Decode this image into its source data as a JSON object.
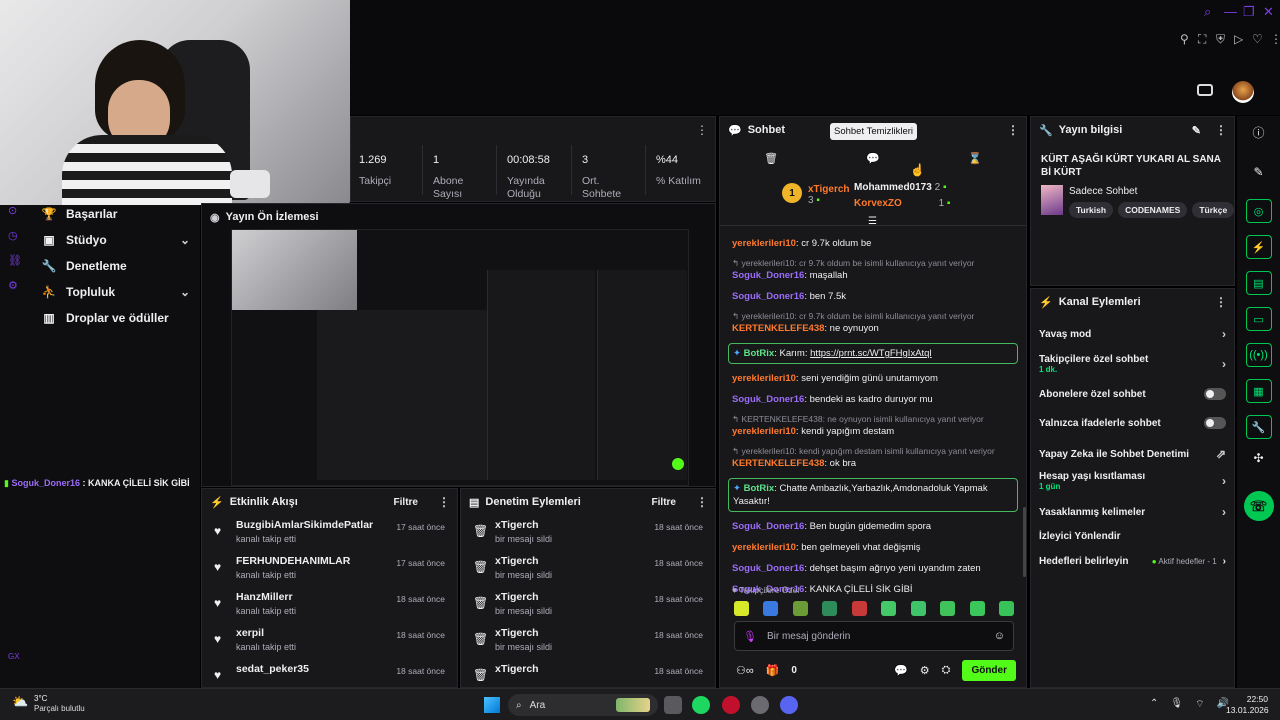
{
  "stats": [
    {
      "value": "1.269",
      "label": "Takipçi"
    },
    {
      "value": "1",
      "label": "Abone Sayısı"
    },
    {
      "value": "00:08:58",
      "label": "Yayında Olduğu"
    },
    {
      "value": "3",
      "label": "Ort. Sohbete"
    },
    {
      "value": "%44",
      "label": "% Katılım"
    }
  ],
  "nav": {
    "items": [
      {
        "label": "Başarılar",
        "icon": "trophy-icon"
      },
      {
        "label": "Stüdyo",
        "icon": "studio-icon"
      },
      {
        "label": "Denetleme",
        "icon": "wrench-icon"
      },
      {
        "label": "Topluluk",
        "icon": "community-icon"
      },
      {
        "label": "Droplar ve ödüller",
        "icon": "gift-icon"
      }
    ]
  },
  "overlay_chat": {
    "user": "Soguk_Doner16",
    "text": " : KANKA ÇİLELİ SİK GİBİ"
  },
  "corner_tag": "GX",
  "preview": {
    "title": "Yayın Ön İzlemesi"
  },
  "activity": {
    "title": "Etkinlik Akışı",
    "filter": "Filtre",
    "items": [
      {
        "name": "BuzgibiAmlarSikimdePatlar",
        "sub": "kanalı takip etti",
        "time": "17 saat önce"
      },
      {
        "name": "FERHUNDEHANIMLAR",
        "sub": "kanalı takip etti",
        "time": "17 saat önce"
      },
      {
        "name": "HanzMillerr",
        "sub": "kanalı takip etti",
        "time": "18 saat önce"
      },
      {
        "name": "xerpil",
        "sub": "kanalı takip etti",
        "time": "18 saat önce"
      },
      {
        "name": "sedat_peker35",
        "sub": "",
        "time": "18 saat önce"
      }
    ]
  },
  "modlog": {
    "title": "Denetim Eylemleri",
    "filter": "Filtre",
    "items": [
      {
        "name": "xTigerch",
        "sub": "bir mesajı sildi",
        "time": "18 saat önce"
      },
      {
        "name": "xTigerch",
        "sub": "bir mesajı sildi",
        "time": "18 saat önce"
      },
      {
        "name": "xTigerch",
        "sub": "bir mesajı sildi",
        "time": "18 saat önce"
      },
      {
        "name": "xTigerch",
        "sub": "bir mesajı sildi",
        "time": "18 saat önce"
      },
      {
        "name": "xTigerch",
        "sub": "",
        "time": "18 saat önce"
      }
    ]
  },
  "chat": {
    "title": "Sohbet",
    "tooltip": "Sohbet Temizlikleri",
    "leaderboard": {
      "rank": "1",
      "top_user": "xTigerch",
      "top_count": "3",
      "second_user": "Mohammed0173",
      "second_count": "2",
      "third_user": "KorvexZO",
      "third_count": "1"
    },
    "messages": [
      {
        "reply": "",
        "user": "yereklerileri10",
        "color": "orange",
        "text": ": cr 9.7k oldum be"
      },
      {
        "reply": "yereklerileri10: cr 9.7k oldum be isimli kullanıcıya yanıt veriyor",
        "user": "Soguk_Doner16",
        "color": "purple",
        "text": ": maşallah"
      },
      {
        "reply": "",
        "user": "Soguk_Doner16",
        "color": "purple",
        "text": ": ben 7.5k"
      },
      {
        "reply": "yereklerileri10: cr 9.7k oldum be isimli kullanıcıya yanıt veriyor",
        "user": "KERTENKELEFE438",
        "color": "orange",
        "text": ": ne oynuyon"
      },
      {
        "reply": "",
        "user": "yereklerileri10",
        "color": "orange",
        "text": ": seni yendiğim günü unutamıyom"
      },
      {
        "reply": "",
        "user": "Soguk_Doner16",
        "color": "purple",
        "text": ": bendeki as kadro duruyor mu"
      },
      {
        "reply": "KERTENKELEFE438: ne oynuyon isimli kullanıcıya yanıt veriyor",
        "user": "yereklerileri10",
        "color": "orange",
        "text": ": kendi yapığım destam"
      },
      {
        "reply": "yereklerileri10: kendi yapığım destam isimli kullanıcıya yanıt veriyor",
        "user": "KERTENKELEFE438",
        "color": "orange",
        "text": ": ok bra"
      },
      {
        "reply": "",
        "user": "Soguk_Doner16",
        "color": "purple",
        "text": ": Ben bugün gidemedim spora"
      },
      {
        "reply": "",
        "user": "yereklerileri10",
        "color": "orange",
        "text": ": ben gelmeyeli vhat değişmiş"
      },
      {
        "reply": "",
        "user": "Soguk_Doner16",
        "color": "purple",
        "text": ": dehşet başım ağrıyo yeni uyandım zaten"
      },
      {
        "reply": "",
        "user": "Soguk_Doner16",
        "color": "purple",
        "text": ": KANKA ÇİLELİ SİK GİBİ"
      }
    ],
    "bot1": {
      "user": "BotRix",
      "text": ": Karım: ",
      "link": "https://prnt.sc/WTgFHgIxAtql"
    },
    "bot2": {
      "user": "BotRix",
      "text": ": Chatte Ambazlık,Yarbazlık,Amdonadoluk Yapmak Yasaktır!"
    },
    "followers_only": "Takipçilere Özel",
    "input_placeholder": "Bir mesaj gönderin",
    "points": "0",
    "send": "Gönder"
  },
  "stream_info": {
    "title": "Yayın bilgisi",
    "stream_title": "KÜRT AŞAĞI KÜRT YUKARI AL SANA Bİ KÜRT",
    "category": "Sadece Sohbet",
    "tags": [
      "Turkish",
      "CODENAMES",
      "Türkçe"
    ]
  },
  "channel_actions": {
    "title": "Kanal Eylemleri",
    "items": [
      {
        "label": "Yavaş mod",
        "sub": "",
        "ctrl": "chevron"
      },
      {
        "label": "Takipçilere özel sohbet",
        "sub": "1 dk.",
        "ctrl": "chevron"
      },
      {
        "label": "Abonelere özel sohbet",
        "sub": "",
        "ctrl": "toggle"
      },
      {
        "label": "Yalnızca ifadelerle sohbet",
        "sub": "",
        "ctrl": "toggle"
      },
      {
        "label": "Yapay Zeka ile Sohbet Denetimi",
        "sub": "",
        "ctrl": "external"
      },
      {
        "label": "Hesap yaşı kısıtlaması",
        "sub": "1 gün",
        "ctrl": "chevron"
      },
      {
        "label": "Yasaklanmış kelimeler",
        "sub": "",
        "ctrl": "chevron"
      },
      {
        "label": "İzleyici Yönlendir",
        "sub": "",
        "ctrl": "none"
      },
      {
        "label": "Hedefleri belirleyin",
        "sub": "",
        "ctrl": "goals"
      }
    ],
    "goals_status": "Aktif hedefler - 1"
  },
  "taskbar": {
    "weather_temp": "3°C",
    "weather_desc": "Parçalı bulutlu",
    "search": "Ara",
    "time": "22:50",
    "date": "13.01.2026"
  },
  "colors": {
    "accent": "#53fc18",
    "panel": "#18181b",
    "bg": "#0e0e10",
    "purple_user": "#9b6cf7",
    "orange_user": "#ff7a2e"
  }
}
